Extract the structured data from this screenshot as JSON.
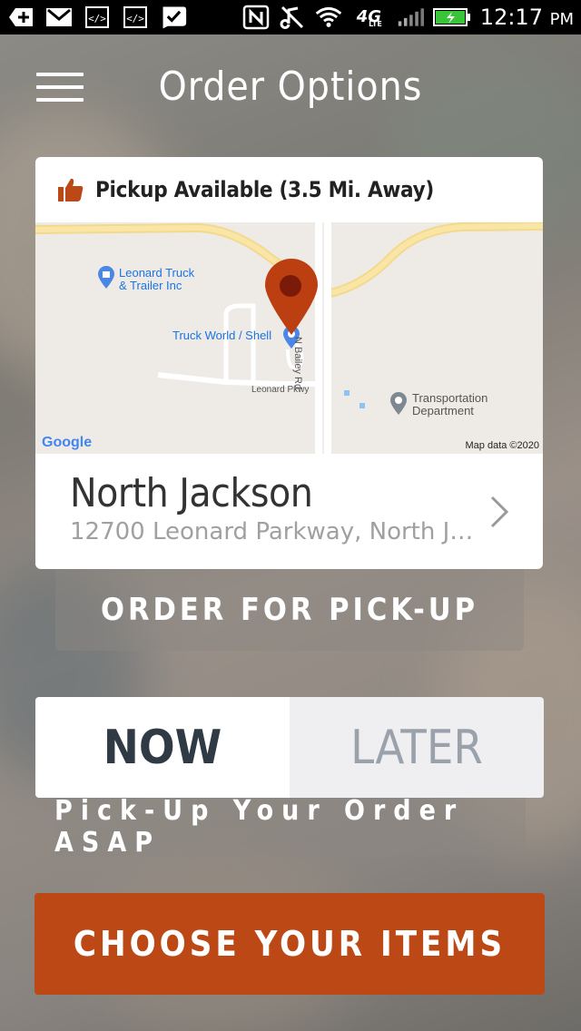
{
  "status_bar": {
    "time": "12:17",
    "ampm": "PM",
    "network": "4G",
    "network_sub": "LTE",
    "icons": [
      "plus-icon",
      "gmail-icon",
      "code-icon",
      "code-icon",
      "check-badge-icon",
      "nfc-icon",
      "mute-icon",
      "wifi-icon",
      "signal-icon",
      "battery-icon"
    ]
  },
  "header": {
    "title": "Order Options",
    "menu_icon": "hamburger-menu-icon"
  },
  "location_card": {
    "availability": "Pickup Available (3.5 Mi. Away)",
    "availability_icon": "thumbs-up-icon",
    "map": {
      "labels": {
        "poi_1_line_1": "Leonard Truck",
        "poi_1_line_2": "& Trailer Inc",
        "poi_2": "Truck World / Shell",
        "road_1": "N Bailey Rd",
        "road_2": "Leonard Pkwy",
        "poi_3_line_1": "Transportation",
        "poi_3_line_2": "Department"
      },
      "google": "Google",
      "copyright": "Map data ©2020"
    },
    "name": "North Jackson",
    "address": "12700 Leonard Parkway, North Jackson",
    "accent_color": "#bc4816"
  },
  "order_for_pickup": "ORDER FOR PICK-UP",
  "timing": {
    "now": "NOW",
    "later": "LATER",
    "selected": "NOW",
    "description": "Pick-Up Your Order ASAP"
  },
  "choose_items": "CHOOSE YOUR ITEMS"
}
